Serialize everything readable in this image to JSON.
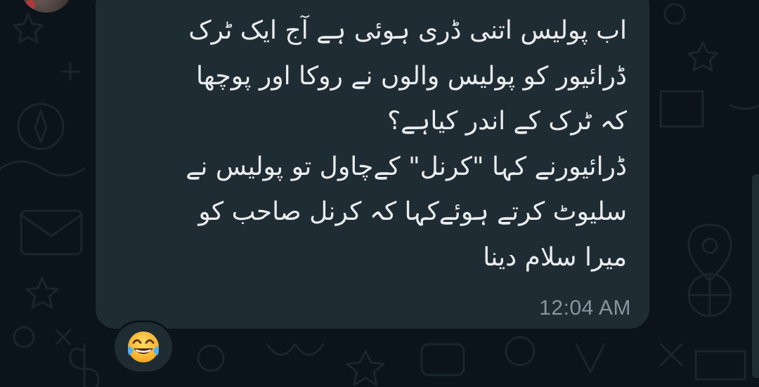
{
  "message": {
    "lines": [
      "اب پولیس اتنی ڈری ہوئی ہے آج ایک ٹرک",
      "ڈرائیور کو پولیس والوں نے روکا اور پوچھا",
      "کہ ٹرک کے اندر کیاہے؟",
      "ڈرائیورنے کہا \"کرنل\" کےچاول تو پولیس نے",
      "سلیوٹ کرتے ہوئےکہا کہ کرنل صاحب کو",
      "میرا سلام دینا"
    ],
    "time": "12:04 AM",
    "reaction_icon": "face-with-tears-of-joy-icon"
  },
  "colors": {
    "background": "#0b141a",
    "bubble": "#202c33",
    "text": "#e9edef",
    "timestamp": "#8696a0"
  }
}
